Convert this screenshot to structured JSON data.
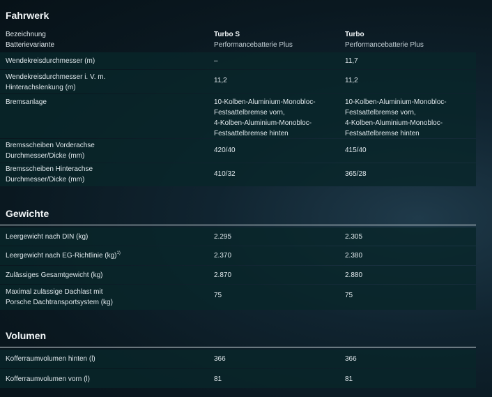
{
  "fahrwerk": {
    "title": "Fahrwerk",
    "header": {
      "label_line1": "Bezeichnung",
      "label_line2": "Batterievariante",
      "col1_name": "Turbo S",
      "col1_sub": "Performancebatterie Plus",
      "col2_name": "Turbo",
      "col2_sub": "Performancebatterie Plus"
    },
    "rows": [
      {
        "label": "Wendekreisdurchmesser (m)",
        "v1": "–",
        "v2": "11,7"
      },
      {
        "label_line1": "Wendekreisdurchmesser i. V. m.",
        "label_line2": "Hinterachslenkung (m)",
        "v1": "11,2",
        "v2": "11,2"
      },
      {
        "label": "Bremsanlage",
        "v1_lines": [
          "10-Kolben-Aluminium-Monobloc-",
          "Festsattelbremse vorn,",
          "4-Kolben-Aluminium-Monobloc-",
          "Festsattelbremse hinten"
        ],
        "v2_lines": [
          "10-Kolben-Aluminium-Monobloc-",
          "Festsattelbremse vorn,",
          "4-Kolben-Aluminium-Monobloc-",
          "Festsattelbremse hinten"
        ]
      },
      {
        "label_line1": "Bremsscheiben Vorderachse",
        "label_line2": "Durchmesser/Dicke (mm)",
        "v1": "420/40",
        "v2": "415/40"
      },
      {
        "label_line1": "Bremsscheiben Hinterachse",
        "label_line2": "Durchmesser/Dicke (mm)",
        "v1": "410/32",
        "v2": "365/28"
      }
    ]
  },
  "gewichte": {
    "title": "Gewichte",
    "rows": [
      {
        "label": "Leergewicht nach DIN (kg)",
        "v1": "2.295",
        "v2": "2.305"
      },
      {
        "label": "Leergewicht nach EG-Richtlinie (kg)",
        "sup": "1)",
        "v1": "2.370",
        "v2": "2.380"
      },
      {
        "label": "Zulässiges Gesamtgewicht (kg)",
        "v1": "2.870",
        "v2": "2.880"
      },
      {
        "label_line1": "Maximal zulässige Dachlast mit",
        "label_line2": "Porsche Dachtransportsystem (kg)",
        "v1": "75",
        "v2": "75"
      }
    ]
  },
  "volumen": {
    "title": "Volumen",
    "rows": [
      {
        "label": "Kofferraumvolumen hinten (l)",
        "v1": "366",
        "v2": "366"
      },
      {
        "label": "Kofferraumvolumen vorn (l)",
        "v1": "81",
        "v2": "81"
      }
    ]
  }
}
